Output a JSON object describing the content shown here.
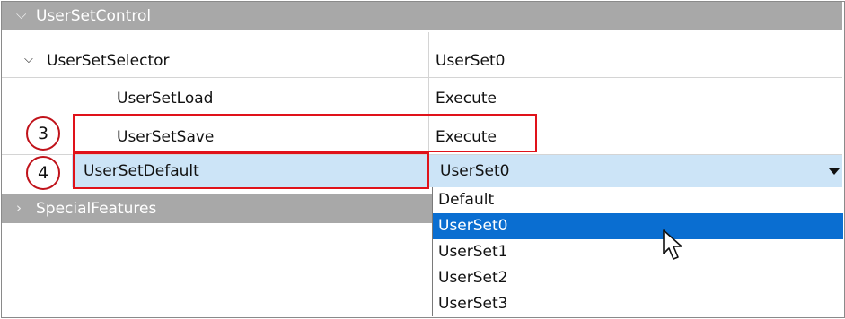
{
  "groups": {
    "user_set_control": "UserSetControl",
    "special_features": "SpecialFeatures"
  },
  "properties": {
    "selector": {
      "name": "UserSetSelector",
      "value": "UserSet0"
    },
    "load": {
      "name": "UserSetLoad",
      "value": "Execute"
    },
    "save": {
      "name": "UserSetSave",
      "value": "Execute"
    },
    "default": {
      "name": "UserSetDefault",
      "value": "UserSet0"
    }
  },
  "dropdown": {
    "options": [
      "Default",
      "UserSet0",
      "UserSet1",
      "UserSet2",
      "UserSet3"
    ],
    "selected": "UserSet0"
  },
  "annotations": {
    "badge_save": "3",
    "badge_default": "4"
  },
  "colors": {
    "header": "#a8a8a8",
    "selected_row": "#cce4f7",
    "highlight": "#0a6ed1",
    "annotation": "#e0121a"
  }
}
